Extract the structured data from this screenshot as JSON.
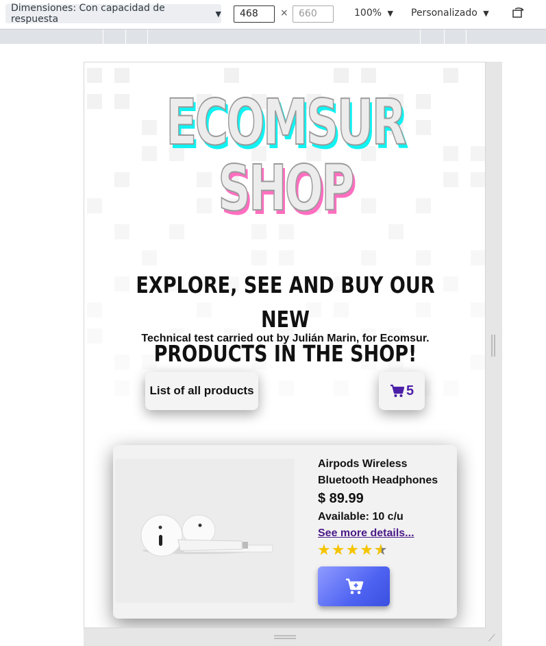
{
  "devtools": {
    "dimensions_label": "Dimensiones: Con capacidad de respuesta",
    "width_value": "468",
    "height_placeholder": "660",
    "times_symbol": "×",
    "zoom": "100%",
    "throttle": "Personalizado"
  },
  "logo": {
    "line1": "ECOMSUR",
    "line2": "SHOP"
  },
  "hero": {
    "headline_line1": "EXPLORE, SEE AND BUY OUR NEW",
    "headline_line2": "PRODUCTS IN THE SHOP!",
    "subtitle": "Technical test carried out by Julián Marin, for Ecomsur."
  },
  "buttons": {
    "list_products": "List of all products",
    "cart_count": "5"
  },
  "product": {
    "title": "Airpods Wireless Bluetooth Headphones",
    "price": "$ 89.99",
    "availability": "Available: 10 c/u",
    "details_link": "See more details...",
    "rating": 4.5,
    "rating_max": 5
  },
  "colors": {
    "cyan": "#11f2f2",
    "pink": "#ff6ec0",
    "accent_purple": "#4b1ea8",
    "button_blue": "#4f63f2",
    "star": "#f5c400"
  },
  "icons": {
    "cart": "cart-icon",
    "add_to_cart": "cart-plus-icon",
    "rotate": "rotate-device-icon"
  }
}
